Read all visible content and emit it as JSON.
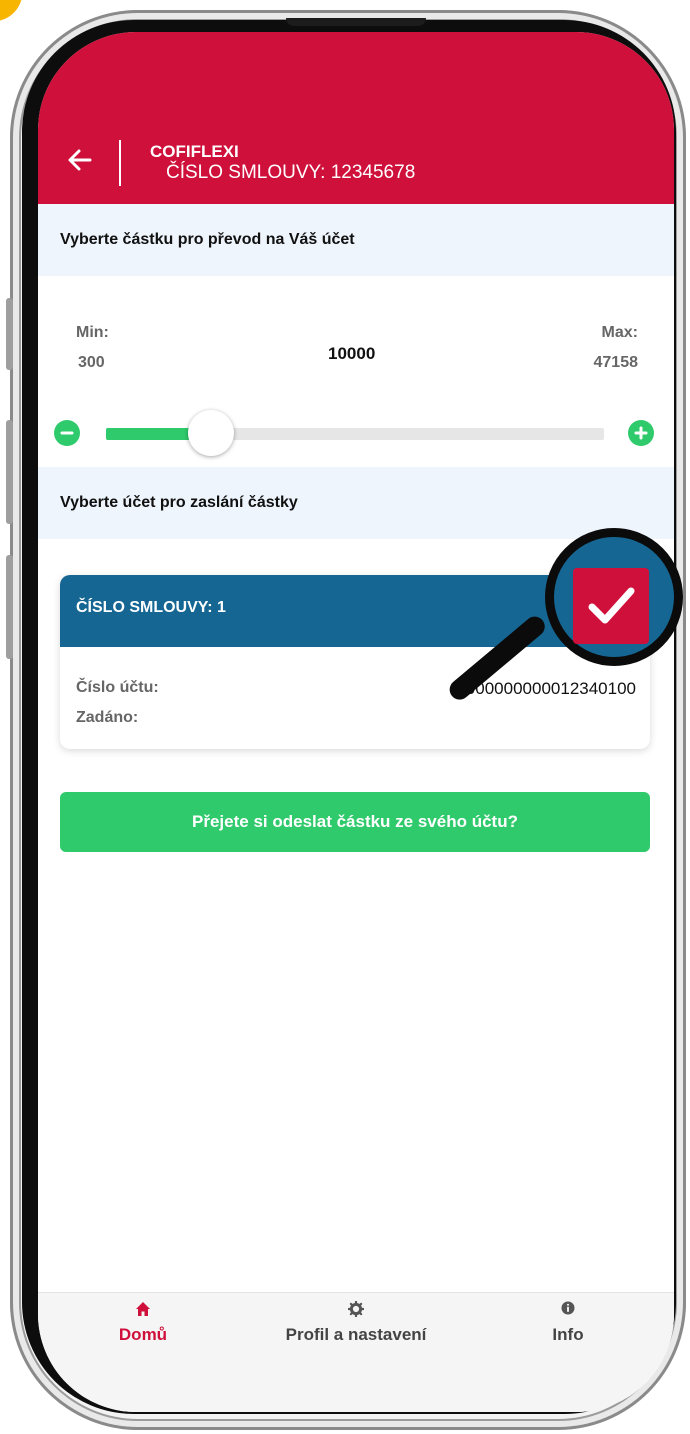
{
  "header": {
    "app_name": "COFIFLEXI",
    "contract_label": "ČÍSLO SMLOUVY: 12345678"
  },
  "amount_section": {
    "title": "Vyberte částku pro převod na Váš účet",
    "min_label": "Min:",
    "min_value": "300",
    "current_value": "10000",
    "max_label": "Max:",
    "max_value": "47158",
    "slider_fraction": 0.207
  },
  "account_section": {
    "title": "Vyberte účet pro zaslání částky",
    "card": {
      "title": "ČÍSLO SMLOUVY: 1",
      "account_label": "Číslo účtu:",
      "account_value": "0000000000012340100",
      "entered_label": "Zadáno:"
    }
  },
  "send_button": "Přejete si odeslat částku ze svého účtu?",
  "bottom_nav": {
    "items": [
      {
        "label": "Domů",
        "icon": "home-icon",
        "active": true
      },
      {
        "label": "Profil a nastavení",
        "icon": "gear-icon",
        "active": false
      },
      {
        "label": "Info",
        "icon": "info-icon",
        "active": false
      }
    ]
  },
  "colors": {
    "brand_red": "#cf103b",
    "accent_green": "#2fca6b",
    "card_blue": "#156693"
  }
}
